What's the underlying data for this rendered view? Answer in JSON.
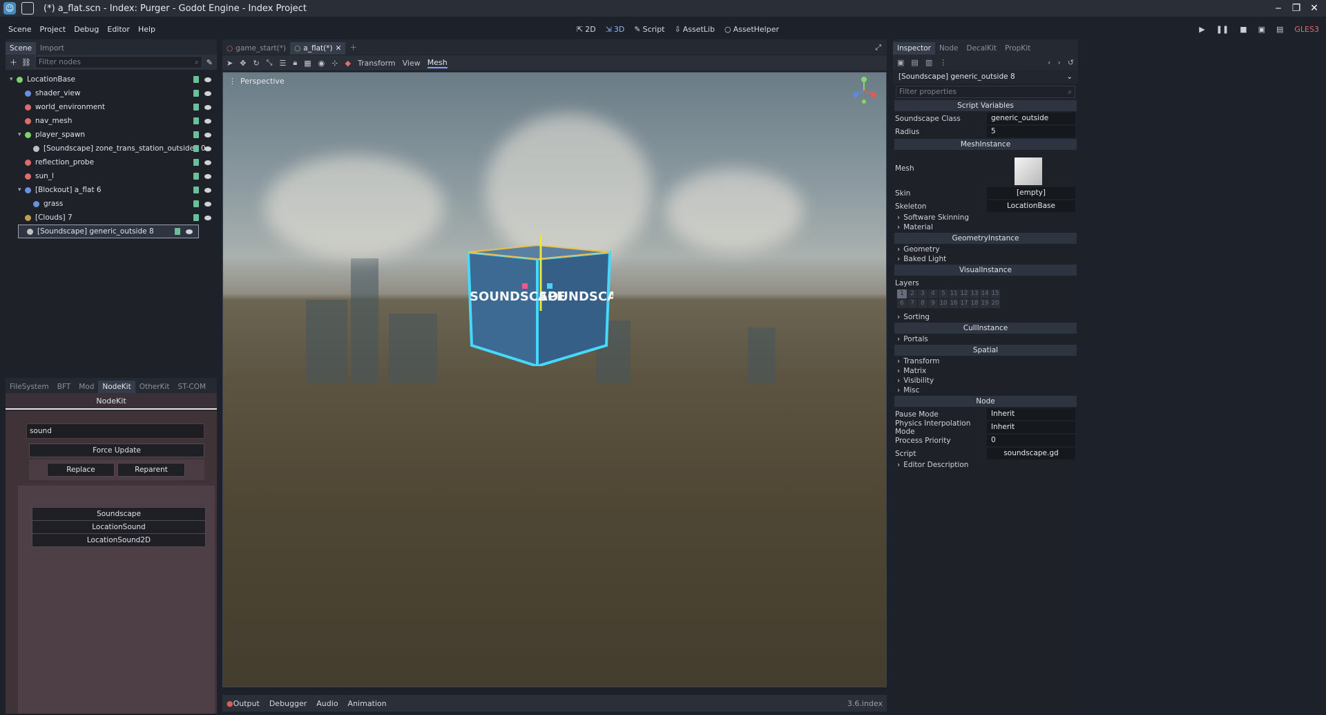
{
  "window": {
    "title": "(*) a_flat.scn - Index: Purger - Godot Engine - Index Project",
    "controls": [
      "‒",
      "❐",
      "✕"
    ]
  },
  "menu": [
    "Scene",
    "Project",
    "Debug",
    "Editor",
    "Help"
  ],
  "workspaces": [
    {
      "label": "2D"
    },
    {
      "label": "3D",
      "active": true
    },
    {
      "label": "Script"
    },
    {
      "label": "AssetLib"
    },
    {
      "label": "AssetHelper"
    }
  ],
  "renderer": "GLES3",
  "scene_dock": {
    "tabs": [
      "Scene",
      "Import"
    ],
    "filter_placeholder": "Filter nodes",
    "nodes": [
      {
        "label": "LocationBase",
        "depth": 0,
        "color": "#7bd36b",
        "arrow": "▾"
      },
      {
        "label": "shader_view",
        "depth": 1,
        "color": "#6b8fe0"
      },
      {
        "label": "world_environment",
        "depth": 1,
        "color": "#e06b6b"
      },
      {
        "label": "nav_mesh",
        "depth": 1,
        "color": "#e06b6b"
      },
      {
        "label": "player_spawn",
        "depth": 1,
        "color": "#7bd36b",
        "arrow": "▾"
      },
      {
        "label": "[Soundscape] zone_trans_station_outside0 0",
        "depth": 2,
        "color": "#c0c0c0"
      },
      {
        "label": "reflection_probe",
        "depth": 1,
        "color": "#e06b6b"
      },
      {
        "label": "sun_l",
        "depth": 1,
        "color": "#e06b6b"
      },
      {
        "label": "[Blockout] a_flat 6",
        "depth": 1,
        "color": "#6b8fe0",
        "arrow": "▾"
      },
      {
        "label": "grass",
        "depth": 2,
        "color": "#6b8fe0"
      },
      {
        "label": "[Clouds] 7",
        "depth": 1,
        "color": "#c0a050"
      },
      {
        "label": "[Soundscape] generic_outside 8",
        "depth": 1,
        "color": "#c0c0c0",
        "selected": true
      }
    ]
  },
  "bottom_dock": {
    "tabs": [
      "FileSystem",
      "BFT",
      "Mod",
      "NodeKit",
      "OtherKit",
      "ST-COM"
    ],
    "active_tab": "NodeKit",
    "title": "NodeKit",
    "search_value": "sound",
    "force_update": "Force Update",
    "replace": "Replace",
    "reparent": "Reparent",
    "results": [
      "Soundscape",
      "LocationSound",
      "LocationSound2D"
    ]
  },
  "editor_tabs": [
    {
      "label": "game_start(*)",
      "active": false
    },
    {
      "label": "a_flat(*)",
      "active": true
    }
  ],
  "viewport_toolbar": {
    "transform": "Transform",
    "view": "View",
    "mesh": "Mesh"
  },
  "viewport": {
    "perspective": "Perspective",
    "cube_text": "SOUNDSCAPE"
  },
  "bottom_panel": {
    "tabs": [
      "Output",
      "Debugger",
      "Audio",
      "Animation"
    ],
    "version": "3.6.index"
  },
  "inspector": {
    "tabs": [
      "Inspector",
      "Node",
      "DecalKit",
      "PropKit"
    ],
    "object": "[Soundscape] generic_outside 8",
    "filter_placeholder": "Filter properties",
    "sections": {
      "script_vars": "Script Variables",
      "mesh_instance": "MeshInstance",
      "geometry_instance": "GeometryInstance",
      "visual_instance": "VisualInstance",
      "cull_instance": "CullInstance",
      "spatial": "Spatial",
      "node": "Node"
    },
    "props": {
      "soundscape_class": {
        "name": "Soundscape Class",
        "value": "generic_outside"
      },
      "radius": {
        "name": "Radius",
        "value": "5"
      },
      "mesh": {
        "name": "Mesh"
      },
      "skin": {
        "name": "Skin",
        "value": "[empty]"
      },
      "skeleton": {
        "name": "Skeleton",
        "value": "LocationBase"
      },
      "layers": {
        "name": "Layers"
      },
      "pause_mode": {
        "name": "Pause Mode",
        "value": "Inherit"
      },
      "physics_interp": {
        "name": "Physics Interpolation Mode",
        "value": "Inherit"
      },
      "process_priority": {
        "name": "Process Priority",
        "value": "0"
      },
      "script": {
        "name": "Script",
        "value": "soundscape.gd"
      }
    },
    "groups": {
      "software_skinning": "Software Skinning",
      "material": "Material",
      "geometry": "Geometry",
      "baked_light": "Baked Light",
      "sorting": "Sorting",
      "portals": "Portals",
      "transform": "Transform",
      "matrix": "Matrix",
      "visibility": "Visibility",
      "misc": "Misc",
      "editor_description": "Editor Description"
    },
    "layer_labels": [
      "1",
      "2",
      "3",
      "4",
      "5",
      "11",
      "12",
      "13",
      "14",
      "15",
      "6",
      "7",
      "8",
      "9",
      "10",
      "16",
      "17",
      "18",
      "19",
      "20"
    ]
  }
}
